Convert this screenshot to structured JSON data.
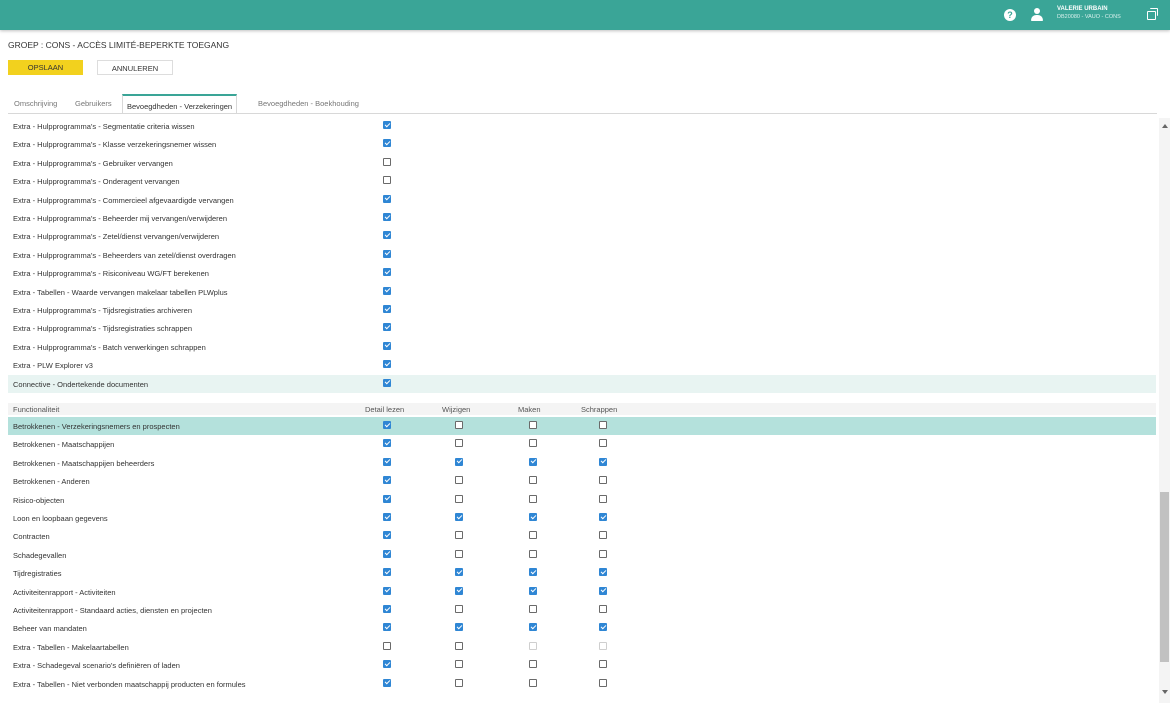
{
  "header": {
    "user_name": "VALERIE URBAIN",
    "user_info": "DB20080 - VAUO - CONS",
    "help_icon": "help-icon",
    "user_icon": "user-icon",
    "window_icon": "window-icon",
    "accent_color": "#3aa597"
  },
  "page": {
    "title": "GROEP : CONS - ACCÈS LIMITÉ-BEPERKTE TOEGANG",
    "save_label": "OPSLAAN",
    "cancel_label": "ANNULEREN"
  },
  "tabs": [
    {
      "label": "Omschrijving",
      "active": false
    },
    {
      "label": "Gebruikers",
      "active": false
    },
    {
      "label": "Bevoegdheden - Verzekeringen",
      "active": true
    },
    {
      "label": "Bevoegdheden - Boekhouding",
      "active": false
    }
  ],
  "extras": [
    {
      "label": "Extra - Hulpprogramma's - Segmentatie criteria wissen",
      "checked": true
    },
    {
      "label": "Extra - Hulpprogramma's - Klasse verzekeringsnemer wissen",
      "checked": true
    },
    {
      "label": "Extra - Hulpprogramma's - Gebruiker vervangen",
      "checked": false
    },
    {
      "label": "Extra - Hulpprogramma's - Onderagent vervangen",
      "checked": false
    },
    {
      "label": "Extra - Hulpprogramma's - Commercieel afgevaardigde vervangen",
      "checked": true
    },
    {
      "label": "Extra - Hulpprogramma's - Beheerder mij vervangen/verwijderen",
      "checked": true
    },
    {
      "label": "Extra - Hulpprogramma's - Zetel/dienst vervangen/verwijderen",
      "checked": true
    },
    {
      "label": "Extra - Hulpprogramma's - Beheerders van zetel/dienst overdragen",
      "checked": true
    },
    {
      "label": "Extra - Hulpprogramma's  - Risiconiveau WG/FT berekenen",
      "checked": true
    },
    {
      "label": "Extra - Tabellen - Waarde vervangen makelaar tabellen PLWplus",
      "checked": true
    },
    {
      "label": "Extra - Hulpprogramma's - Tijdsregistraties archiveren",
      "checked": true
    },
    {
      "label": "Extra - Hulpprogramma's - Tijdsregistraties schrappen",
      "checked": true
    },
    {
      "label": "Extra - Hulpprogramma's - Batch verwerkingen schrappen",
      "checked": true
    },
    {
      "label": "Extra - PLW Explorer v3",
      "checked": true
    },
    {
      "label": "Connective - Ondertekende documenten",
      "checked": true
    }
  ],
  "func_header": {
    "name": "Functionaliteit",
    "read": "Detail lezen",
    "edit": "Wijzigen",
    "create": "Maken",
    "delete": "Schrappen"
  },
  "functions": [
    {
      "label": "Betrokkenen - Verzekeringsnemers en prospecten",
      "perms": [
        "on",
        "off",
        "off",
        "off"
      ]
    },
    {
      "label": "Betrokkenen - Maatschappijen",
      "perms": [
        "on",
        "off",
        "off",
        "off"
      ]
    },
    {
      "label": "Betrokkenen - Maatschappijen beheerders",
      "perms": [
        "on",
        "on",
        "on",
        "on"
      ]
    },
    {
      "label": "Betrokkenen - Anderen",
      "perms": [
        "on",
        "off",
        "off",
        "off"
      ]
    },
    {
      "label": "Risico-objecten",
      "perms": [
        "on",
        "off",
        "off",
        "off"
      ]
    },
    {
      "label": "Loon en loopbaan gegevens",
      "perms": [
        "on",
        "on",
        "on",
        "on"
      ]
    },
    {
      "label": "Contracten",
      "perms": [
        "on",
        "off",
        "off",
        "off"
      ]
    },
    {
      "label": "Schadegevallen",
      "perms": [
        "on",
        "off",
        "off",
        "off"
      ]
    },
    {
      "label": "Tijdregistraties",
      "perms": [
        "on",
        "on",
        "on",
        "on"
      ]
    },
    {
      "label": "Activiteitenrapport - Activiteiten",
      "perms": [
        "on",
        "on",
        "on",
        "on"
      ]
    },
    {
      "label": "Activiteitenrapport - Standaard acties, diensten en projecten",
      "perms": [
        "on",
        "off",
        "off",
        "off"
      ]
    },
    {
      "label": "Beheer van mandaten",
      "perms": [
        "on",
        "on",
        "on",
        "on"
      ]
    },
    {
      "label": "Extra - Tabellen - Makelaartabellen",
      "perms": [
        "off",
        "off",
        "dis",
        "dis"
      ]
    },
    {
      "label": "Extra - Schadegeval scenario's definiëren of laden",
      "perms": [
        "on",
        "off",
        "off",
        "off"
      ]
    },
    {
      "label": "Extra - Tabellen - Niet verbonden maatschappij producten en formules",
      "perms": [
        "on",
        "off",
        "off",
        "off"
      ]
    }
  ]
}
